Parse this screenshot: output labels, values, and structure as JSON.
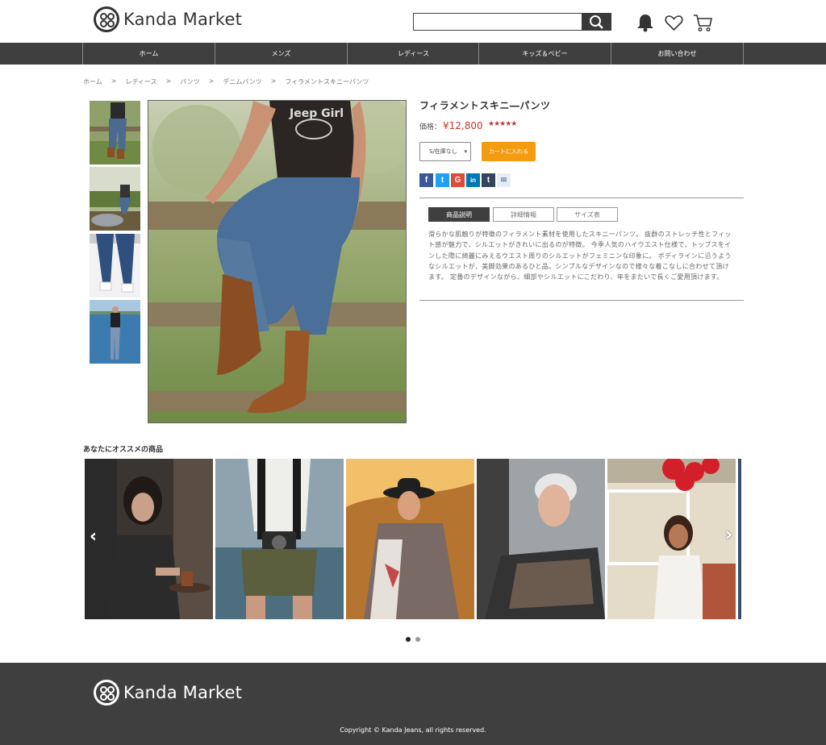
{
  "header": {
    "logo_text": "Kanda Market",
    "search_placeholder": "",
    "icons": [
      "bell-icon",
      "heart-icon",
      "cart-icon",
      "search-icon"
    ]
  },
  "nav": {
    "items": [
      "ホーム",
      "メンズ",
      "レディース",
      "キッズ＆ベビー",
      "お問い合わせ"
    ]
  },
  "breadcrumb": [
    "ホーム",
    "レディース",
    "パンツ",
    "デニムパンツ",
    "フィラメントスキニーパンツ"
  ],
  "product": {
    "title": "フィラメントスキニ―パンツ",
    "price_label": "価格：",
    "price": "¥12,800",
    "rating_stars": "★★★★★",
    "rating": 4.5,
    "select_value": "S/在庫なし",
    "cart_button": "カートに入れる",
    "social": [
      "f",
      "t",
      "G",
      "in",
      "t",
      "✉"
    ],
    "tabs": [
      "商品説明",
      "詳細情報",
      "サイズ表"
    ],
    "active_tab": 0,
    "description": "滑らかな肌触りが特徴のフィラメント素材を使用したスキニーパンツ。 抜群のストレッチ性とフィット感が魅力で、シルエットがきれいに出るのが特徴。 今季人気のハイウエスト仕様で、トップスをインした際に綺麗にみえるウエスト周りのシルエットがフェミニンな印象に。 ボディラインに沿うようなシルエットが、美脚効果のあるひと品。シンプルなデザインなので様々な着こなしに合わせて頂けます。 定番のデザインながら、細部やシルエットにこだわり、年をまたいで長くご愛用頂けます。",
    "colors": {
      "price": "#c0392b",
      "cart_button": "#f39c12",
      "dark": "#3f3f3f"
    }
  },
  "recommendations": {
    "title": "あなたにオススメの商品",
    "carousel_page": 1,
    "carousel_pages": 2
  },
  "footer": {
    "logo_text": "Kanda Market",
    "copyright": "Copyright © Kanda Jeans, all rights reserved."
  }
}
